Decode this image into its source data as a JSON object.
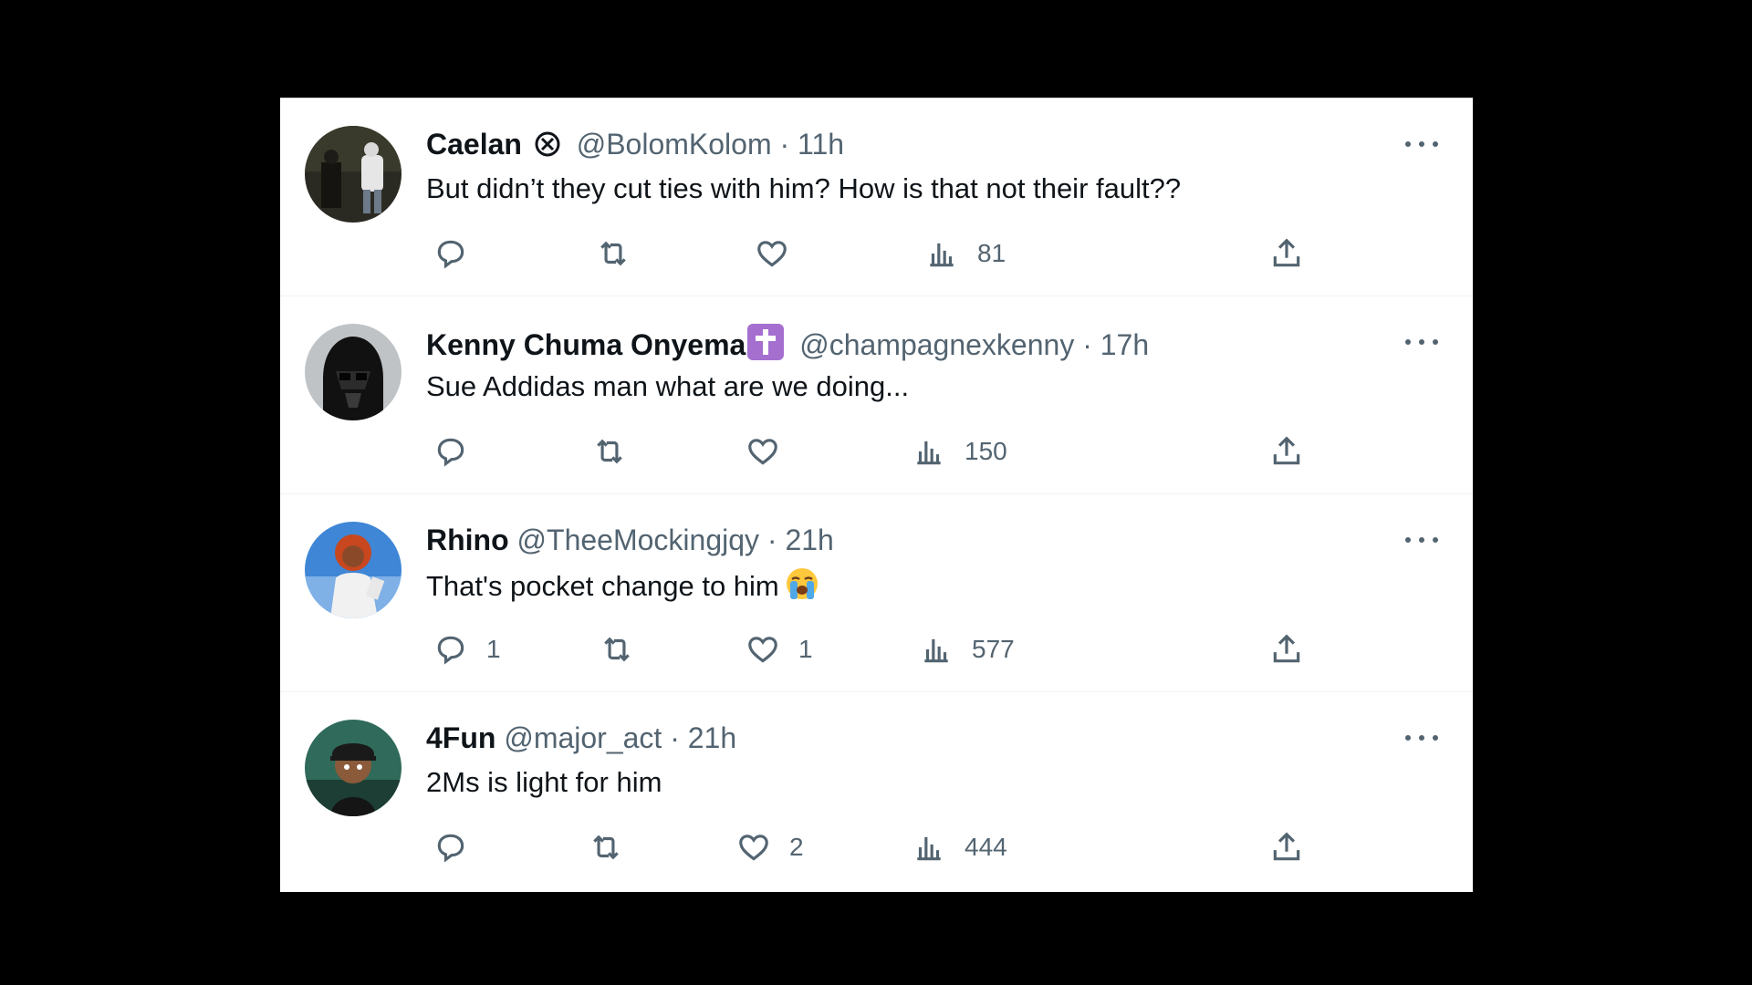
{
  "tweets": [
    {
      "name": "Caelan",
      "badge": "circle-x-icon",
      "handle": "@BolomKolom",
      "time": "· 11h",
      "text": "But didn’t they cut ties with him? How is that not their fault??",
      "replies": "",
      "likes": "",
      "views": "81"
    },
    {
      "name": "Kenny Chuma Onyema",
      "badge": "latin-cross-icon",
      "handle": "@champagnexkenny",
      "time": "· 17h",
      "text": "Sue Addidas man what are we doing...",
      "replies": "",
      "likes": "",
      "views": "150"
    },
    {
      "name": "Rhino",
      "handle": "@TheeMockingjqy",
      "time": "· 21h",
      "text": "That's pocket change to him",
      "emoji": "loudly-crying-face-emoji",
      "replies": "1",
      "likes": "1",
      "views": "577"
    },
    {
      "name": "4Fun",
      "handle": "@major_act",
      "time": "· 21h",
      "text": "2Ms is light for him",
      "replies": "",
      "likes": "2",
      "views": "444"
    }
  ],
  "colors": {
    "background": "#000000",
    "panel": "#ffffff",
    "text_primary": "#0f1419",
    "text_secondary": "#536471",
    "cross_badge": "#a56fd0"
  }
}
